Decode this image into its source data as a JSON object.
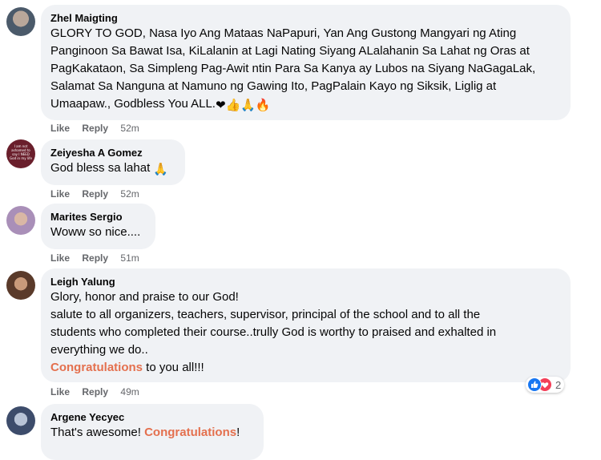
{
  "comments": [
    {
      "author": "Zhel Maigting",
      "lines": [
        "GLORY TO GOD, Nasa Iyo Ang Mataas NaPapuri, Yan Ang Gustong Mangyari ng Ating",
        "Panginoon Sa Bawat Isa, KiLalanin at Lagi Nating Siyang ALalahanin Sa Lahat ng Oras at",
        "PagKakataon, Sa Simpleng Pag-Awit ntin Para Sa Kanya ay Lubos na Siyang NaGagaLak,",
        "Salamat Sa Nanguna at Namuno ng Gawing Ito, PagPalain Kayo ng Siksik, Liglig at",
        "Umaapaw., Godbless You ALL."
      ],
      "emojis": "❤👍🙏🔥",
      "like": "Like",
      "reply": "Reply",
      "time": "52m"
    },
    {
      "author": "Zeiyesha A Gomez",
      "avatar_text": "I am not ashamed to say I NEED God in my life",
      "text": "God bless sa lahat",
      "emojis": "🙏",
      "like": "Like",
      "reply": "Reply",
      "time": "52m"
    },
    {
      "author": "Marites Sergio",
      "text": "Woww so nice....",
      "like": "Like",
      "reply": "Reply",
      "time": "51m"
    },
    {
      "author": "Leigh Yalung",
      "lines": [
        "Glory, honor and praise to our God!",
        "salute to all organizers, teachers, supervisor, principal of the school and to all the",
        "students who completed their course..trully God is worthy to praised and exhalted in",
        "everything we do.."
      ],
      "highlight": "Congratulations",
      "after_highlight": " to you all!!!",
      "reaction_count": "2",
      "like": "Like",
      "reply": "Reply",
      "time": "49m"
    },
    {
      "author": "Argene Yecyec",
      "text_before": "That's awesome! ",
      "highlight": "Congratulations",
      "text_after": "!"
    }
  ],
  "colors": {
    "bubble": "#f0f2f5",
    "highlight": "#e4704e",
    "meta": "#65676b",
    "like_blue": "#1877f2",
    "love_red": "#f33e58"
  }
}
